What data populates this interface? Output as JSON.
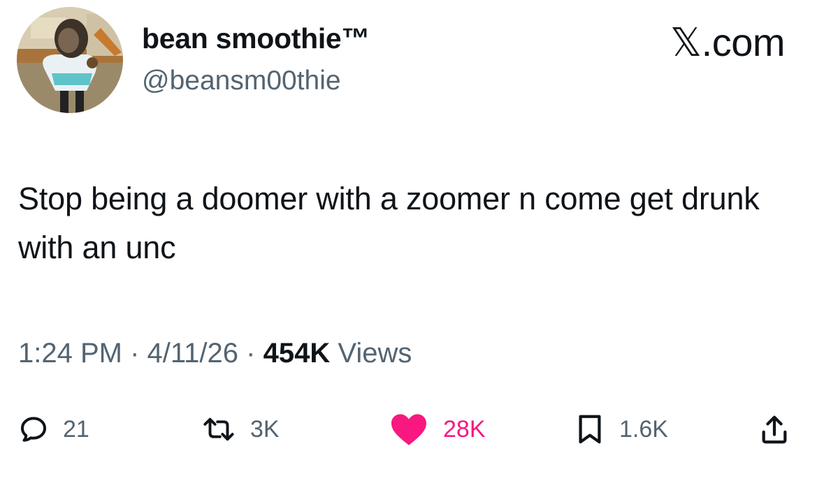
{
  "author": {
    "display_name": "bean smoothie™",
    "handle": "@beansm00thie"
  },
  "site_watermark": "𝕏.com",
  "tweet": {
    "text": "Stop being a doomer with a zoomer n come get drunk with an unc"
  },
  "meta": {
    "time": "1:24 PM",
    "date": "4/11/26",
    "separator": "·",
    "views_count": "454K",
    "views_label": "Views"
  },
  "actions": {
    "replies": "21",
    "reposts": "3K",
    "likes": "28K",
    "bookmarks": "1.6K"
  },
  "icons": [
    "reply-icon",
    "repost-icon",
    "heart-icon",
    "bookmark-icon",
    "share-icon"
  ],
  "colors": {
    "text": "#0f1419",
    "secondary": "#536471",
    "like": "#f91880"
  }
}
